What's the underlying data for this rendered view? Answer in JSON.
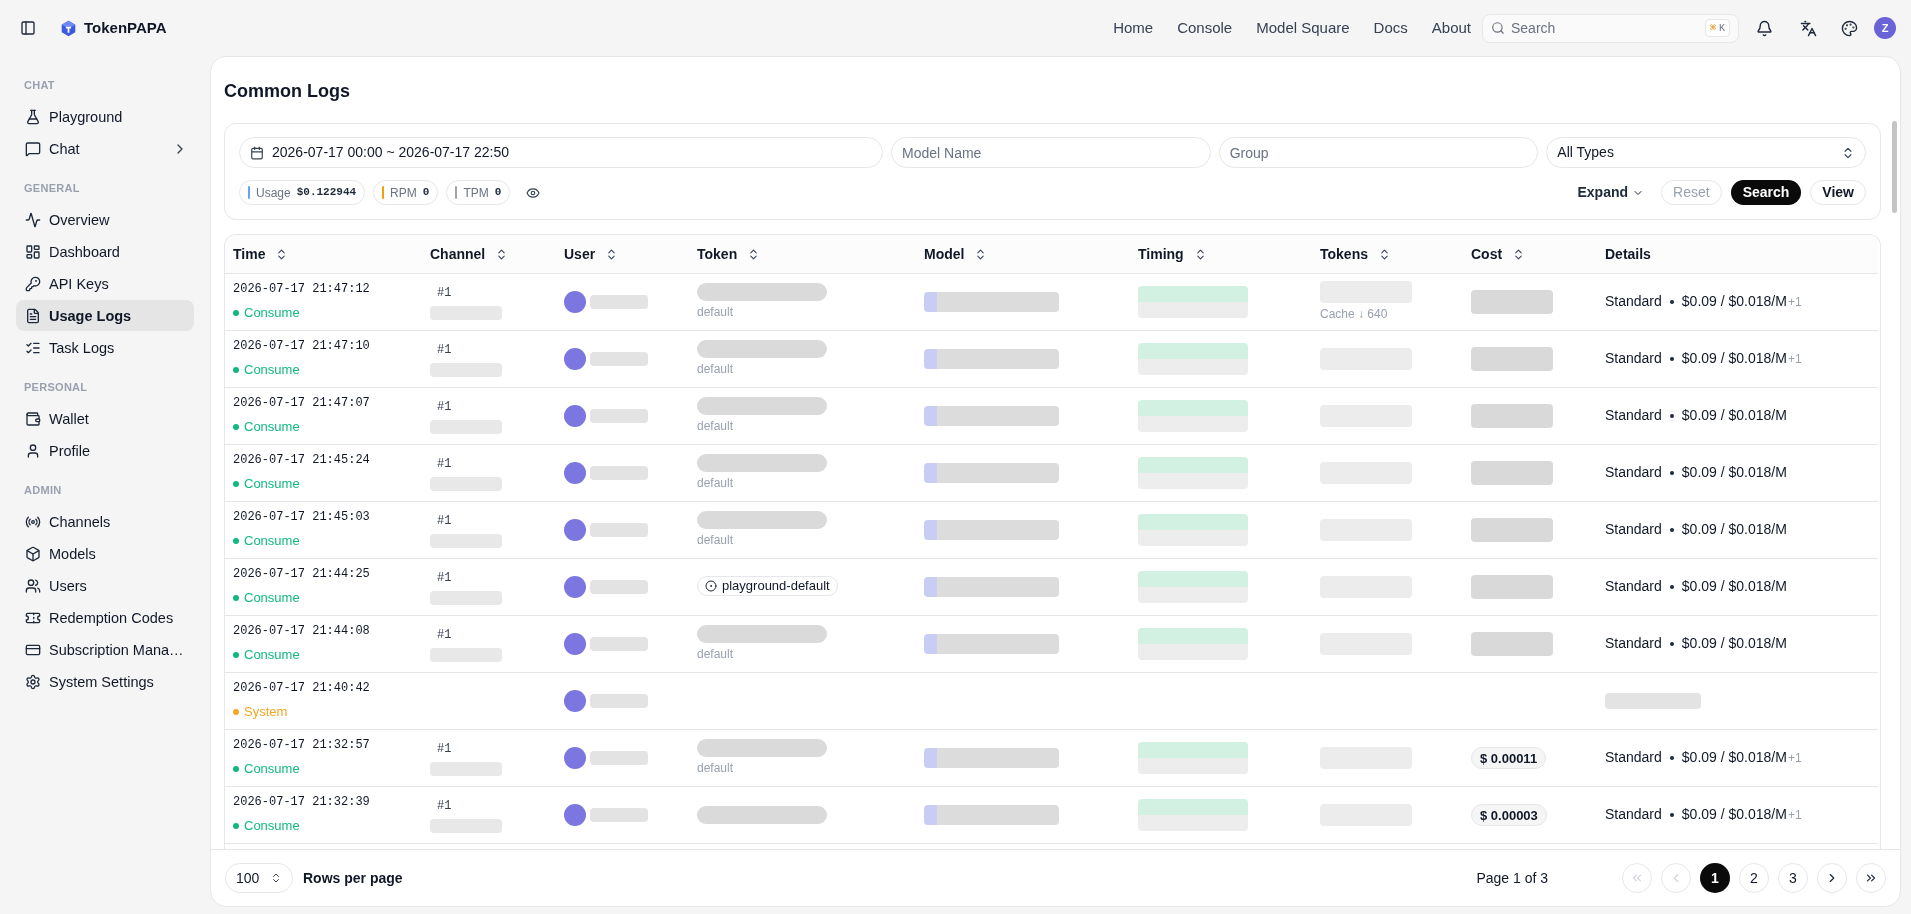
{
  "header": {
    "brand": "TokenPAPA",
    "nav": [
      "Home",
      "Console",
      "Model Square",
      "Docs",
      "About"
    ],
    "search": {
      "placeholder": "Search",
      "shortcut": [
        "⌘",
        "K"
      ]
    },
    "avatar": "Z"
  },
  "sidebar": [
    {
      "title": "CHAT",
      "items": [
        {
          "label": "Playground",
          "selected": false,
          "submenu": false
        },
        {
          "label": "Chat",
          "selected": false,
          "submenu": true
        }
      ]
    },
    {
      "title": "GENERAL",
      "items": [
        {
          "label": "Overview",
          "selected": false,
          "submenu": false
        },
        {
          "label": "Dashboard",
          "selected": false,
          "submenu": false
        },
        {
          "label": "API Keys",
          "selected": false,
          "submenu": false
        },
        {
          "label": "Usage Logs",
          "selected": true,
          "submenu": false
        },
        {
          "label": "Task Logs",
          "selected": false,
          "submenu": false
        }
      ]
    },
    {
      "title": "PERSONAL",
      "items": [
        {
          "label": "Wallet",
          "selected": false,
          "submenu": false
        },
        {
          "label": "Profile",
          "selected": false,
          "submenu": false
        }
      ]
    },
    {
      "title": "ADMIN",
      "items": [
        {
          "label": "Channels",
          "selected": false,
          "submenu": false
        },
        {
          "label": "Models",
          "selected": false,
          "submenu": false
        },
        {
          "label": "Users",
          "selected": false,
          "submenu": false
        },
        {
          "label": "Redemption Codes",
          "selected": false,
          "submenu": false
        },
        {
          "label": "Subscription Mana…",
          "selected": false,
          "submenu": false
        },
        {
          "label": "System Settings",
          "selected": false,
          "submenu": false
        }
      ]
    }
  ],
  "page_title": "Common Logs",
  "filters": {
    "date_range": "2026-07-17 00:00 ~ 2026-07-17 22:50",
    "model_field": {
      "placeholder": "Model Name"
    },
    "group_field": {
      "placeholder": "Group"
    },
    "type_select": "All Types",
    "stats": [
      {
        "label": "Usage",
        "value": "$0.122944",
        "color": "#60a5fa"
      },
      {
        "label": "RPM",
        "value": "0",
        "color": "#f59e0b"
      },
      {
        "label": "TPM",
        "value": "0",
        "color": "#a3a3a3"
      }
    ],
    "buttons": [
      {
        "label": "Expand",
        "kind": "dropdown",
        "disabled": false
      },
      {
        "label": "Reset",
        "kind": "outline",
        "disabled": true
      },
      {
        "label": "Search",
        "kind": "primary",
        "disabled": false
      },
      {
        "label": "View",
        "kind": "outline",
        "disabled": false
      }
    ]
  },
  "table": {
    "columns": [
      {
        "label": "Time",
        "sortable": true
      },
      {
        "label": "Channel",
        "sortable": true
      },
      {
        "label": "User",
        "sortable": true
      },
      {
        "label": "Token",
        "sortable": true
      },
      {
        "label": "Model",
        "sortable": true
      },
      {
        "label": "Timing",
        "sortable": true
      },
      {
        "label": "Tokens",
        "sortable": true
      },
      {
        "label": "Cost",
        "sortable": true
      },
      {
        "label": "Details",
        "sortable": false
      }
    ],
    "rows": [
      {
        "time": "2026-07-17 21:47:12",
        "kind": "consume",
        "type": {
          "label": "Consume",
          "color": "#10b981"
        },
        "channel": "#1",
        "token_group": "default",
        "tokens_note": "Cache ↓ 640",
        "details": {
          "tier": "Standard",
          "price": "$0.09 / $0.018/M",
          "extra": "+1"
        }
      },
      {
        "time": "2026-07-17 21:47:10",
        "kind": "consume",
        "type": {
          "label": "Consume",
          "color": "#10b981"
        },
        "channel": "#1",
        "token_group": "default",
        "details": {
          "tier": "Standard",
          "price": "$0.09 / $0.018/M",
          "extra": "+1"
        }
      },
      {
        "time": "2026-07-17 21:47:07",
        "kind": "consume",
        "type": {
          "label": "Consume",
          "color": "#10b981"
        },
        "channel": "#1",
        "token_group": "default",
        "details": {
          "tier": "Standard",
          "price": "$0.09 / $0.018/M"
        }
      },
      {
        "time": "2026-07-17 21:45:24",
        "kind": "consume",
        "type": {
          "label": "Consume",
          "color": "#10b981"
        },
        "channel": "#1",
        "token_group": "default",
        "details": {
          "tier": "Standard",
          "price": "$0.09 / $0.018/M"
        }
      },
      {
        "time": "2026-07-17 21:45:03",
        "kind": "consume",
        "type": {
          "label": "Consume",
          "color": "#10b981"
        },
        "channel": "#1",
        "token_group": "default",
        "details": {
          "tier": "Standard",
          "price": "$0.09 / $0.018/M"
        }
      },
      {
        "time": "2026-07-17 21:44:25",
        "kind": "consume",
        "type": {
          "label": "Consume",
          "color": "#10b981"
        },
        "channel": "#1",
        "token": "playground-default",
        "details": {
          "tier": "Standard",
          "price": "$0.09 / $0.018/M"
        }
      },
      {
        "time": "2026-07-17 21:44:08",
        "kind": "consume",
        "type": {
          "label": "Consume",
          "color": "#10b981"
        },
        "channel": "#1",
        "token_group": "default",
        "details": {
          "tier": "Standard",
          "price": "$0.09 / $0.018/M"
        }
      },
      {
        "time": "2026-07-17 21:40:42",
        "kind": "system",
        "type": {
          "label": "System",
          "color": "#f5a623"
        }
      },
      {
        "time": "2026-07-17 21:32:57",
        "kind": "consume",
        "type": {
          "label": "Consume",
          "color": "#10b981"
        },
        "channel": "#1",
        "token_group": "default",
        "cost": "$ 0.00011",
        "details": {
          "tier": "Standard",
          "price": "$0.09 / $0.018/M",
          "extra": "+1"
        }
      },
      {
        "time": "2026-07-17 21:32:39",
        "kind": "consume",
        "type": {
          "label": "Consume",
          "color": "#10b981"
        },
        "channel": "#1",
        "cost": "$ 0.00003",
        "details": {
          "tier": "Standard",
          "price": "$0.09 / $0.018/M",
          "extra": "+1"
        }
      }
    ]
  },
  "footer": {
    "page_size": "100",
    "page_size_label": "Rows per page",
    "page_info": "Page 1 of 3",
    "first_page": {
      "disabled": true
    },
    "prev_page": {
      "disabled": true
    },
    "pages": [
      {
        "label": "1",
        "selected": true
      },
      {
        "label": "2",
        "selected": false
      },
      {
        "label": "3",
        "selected": false
      }
    ],
    "next_page": {
      "disabled": false
    },
    "last_page": {
      "disabled": false
    }
  }
}
